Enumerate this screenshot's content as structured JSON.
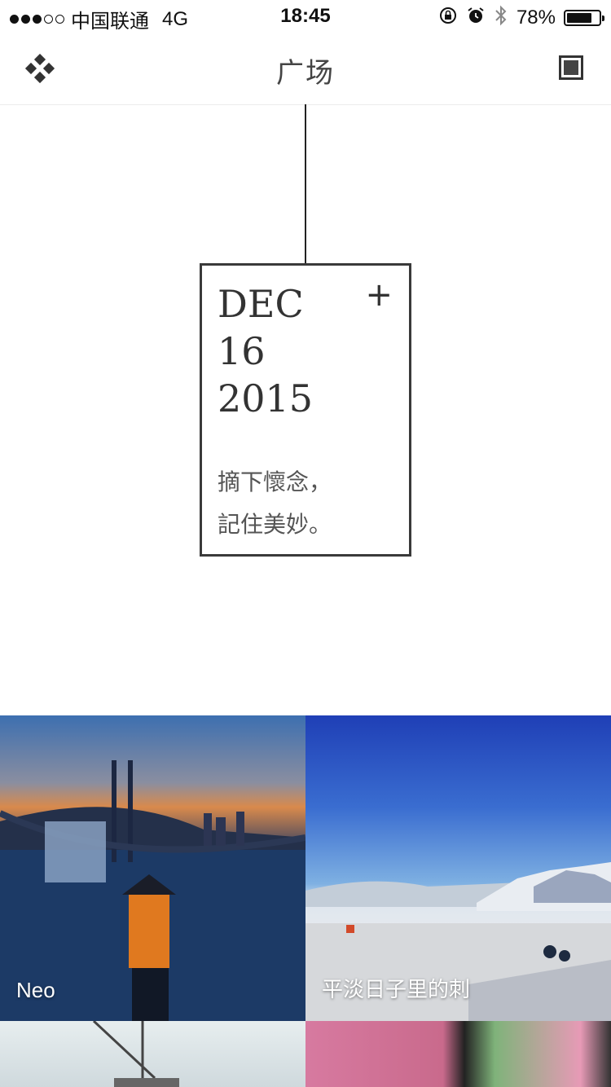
{
  "status_bar": {
    "carrier": "中国联通",
    "network": "4G",
    "time": "18:45",
    "battery_percent_label": "78%",
    "battery_level": 0.78,
    "signal_bars": [
      true,
      true,
      true,
      false,
      false
    ]
  },
  "nav": {
    "title": "广场",
    "left_icon": "diamond-grid-icon",
    "right_icon": "square-icon"
  },
  "card": {
    "month": "DEC",
    "day": "16",
    "year": "2015",
    "quote_line1": "摘下懷念，",
    "quote_line2": "記住美妙。",
    "add_icon": "plus-icon"
  },
  "tiles": [
    {
      "caption": "Neo"
    },
    {
      "caption": "平淡日子里的刺"
    },
    {
      "caption": ""
    },
    {
      "caption": ""
    }
  ],
  "colors": {
    "text": "#333333",
    "divider": "#ececec"
  }
}
